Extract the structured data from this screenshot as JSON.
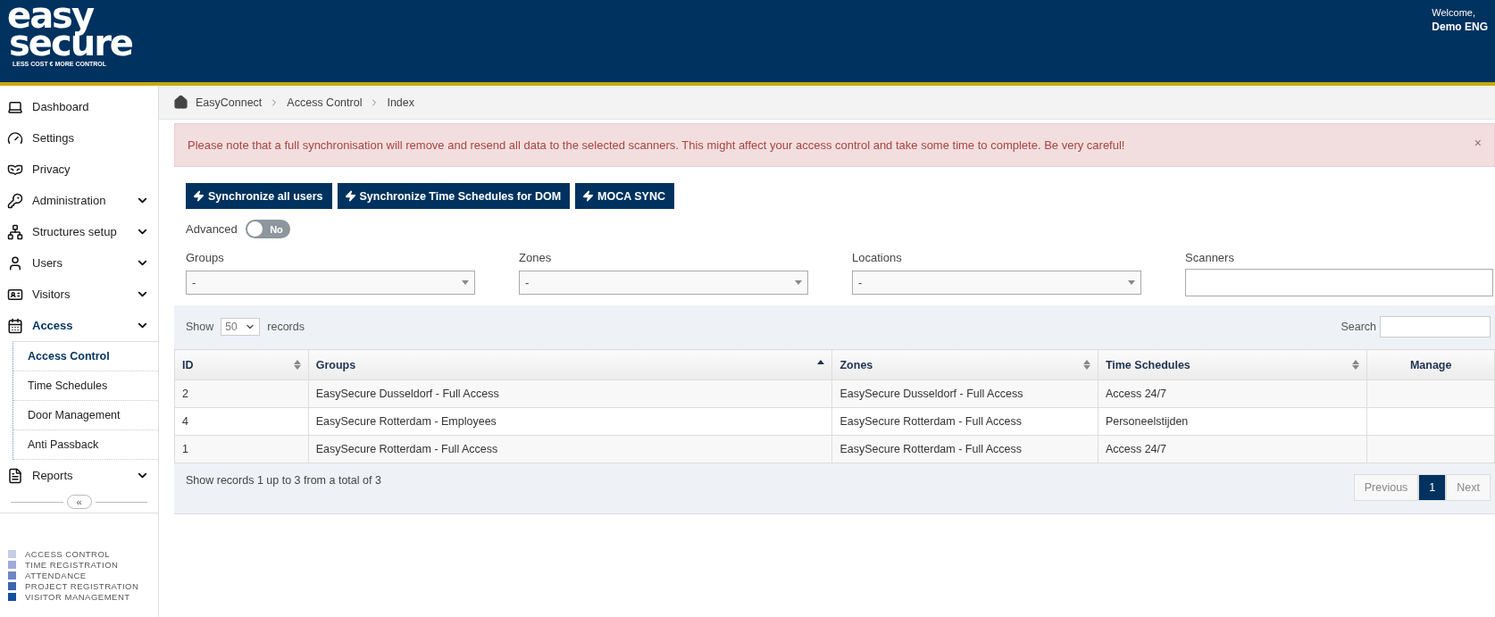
{
  "header": {
    "logo_top": "easy",
    "logo_bottom": "secure",
    "tagline": "LESS COST € MORE CONTROL",
    "welcome": "Welcome,",
    "user": "Demo ENG"
  },
  "sidebar": {
    "items": [
      {
        "label": "Dashboard",
        "expandable": false,
        "selected": false
      },
      {
        "label": "Settings",
        "expandable": false,
        "selected": false
      },
      {
        "label": "Privacy",
        "expandable": false,
        "selected": false
      },
      {
        "label": "Administration",
        "expandable": true,
        "selected": false
      },
      {
        "label": "Structures setup",
        "expandable": true,
        "selected": false
      },
      {
        "label": "Users",
        "expandable": true,
        "selected": false
      },
      {
        "label": "Visitors",
        "expandable": true,
        "selected": false
      },
      {
        "label": "Access",
        "expandable": true,
        "selected": true,
        "children": [
          {
            "label": "Access Control",
            "selected": true
          },
          {
            "label": "Time Schedules",
            "selected": false
          },
          {
            "label": "Door Management",
            "selected": false
          },
          {
            "label": "Anti Passback",
            "selected": false
          }
        ]
      },
      {
        "label": "Reports",
        "expandable": true,
        "selected": false
      }
    ],
    "collapse": "«",
    "legend": [
      {
        "label": "ACCESS CONTROL",
        "color": "#c5cde6"
      },
      {
        "label": "TIME REGISTRATION",
        "color": "#9fabd8"
      },
      {
        "label": "ATTENDANCE",
        "color": "#7186c4"
      },
      {
        "label": "PROJECT REGISTRATION",
        "color": "#3f63b0"
      },
      {
        "label": "VISITOR MANAGEMENT",
        "color": "#134f9e"
      }
    ]
  },
  "breadcrumb": [
    "EasyConnect",
    "Access Control",
    "Index"
  ],
  "alert": {
    "text": "Please note that a full synchronisation will remove and resend all data to the selected scanners. This might affect your access control and take some time to complete. Be very careful!",
    "close": "×"
  },
  "buttons": [
    "Synchronize all users",
    "Synchronize Time Schedules for DOM",
    "MOCA SYNC"
  ],
  "advanced": {
    "label": "Advanced",
    "on": false,
    "state_text": "No"
  },
  "filters": [
    {
      "label": "Groups",
      "kind": "select",
      "value": "-"
    },
    {
      "label": "Zones",
      "kind": "select",
      "value": "-"
    },
    {
      "label": "Locations",
      "kind": "select",
      "value": "-"
    },
    {
      "label": "Scanners",
      "kind": "input"
    }
  ],
  "table": {
    "show_label": "Show",
    "page_size": "50",
    "records_label": "records",
    "search_label": "Search",
    "columns": [
      {
        "label": "ID",
        "sortable": true,
        "sorted": false
      },
      {
        "label": "Groups",
        "sortable": true,
        "sorted": true
      },
      {
        "label": "Zones",
        "sortable": true,
        "sorted": false
      },
      {
        "label": "Time Schedules",
        "sortable": true,
        "sorted": false
      },
      {
        "label": "Manage",
        "sortable": false
      }
    ],
    "rows": [
      [
        "2",
        "EasySecure Dusseldorf - Full Access",
        "EasySecure Dusseldorf - Full Access",
        "Access 24/7",
        ""
      ],
      [
        "4",
        "EasySecure Rotterdam - Employees",
        "EasySecure Rotterdam - Full Access",
        "Personeelstijden",
        ""
      ],
      [
        "1",
        "EasySecure Rotterdam - Full Access",
        "EasySecure Rotterdam - Full Access",
        "Access 24/7",
        ""
      ]
    ],
    "summary": "Show records 1 up to 3 from a total of 3",
    "pagination": [
      {
        "label": "Previous",
        "selected": false
      },
      {
        "label": "1",
        "selected": true
      },
      {
        "label": "Next",
        "selected": false
      }
    ]
  }
}
